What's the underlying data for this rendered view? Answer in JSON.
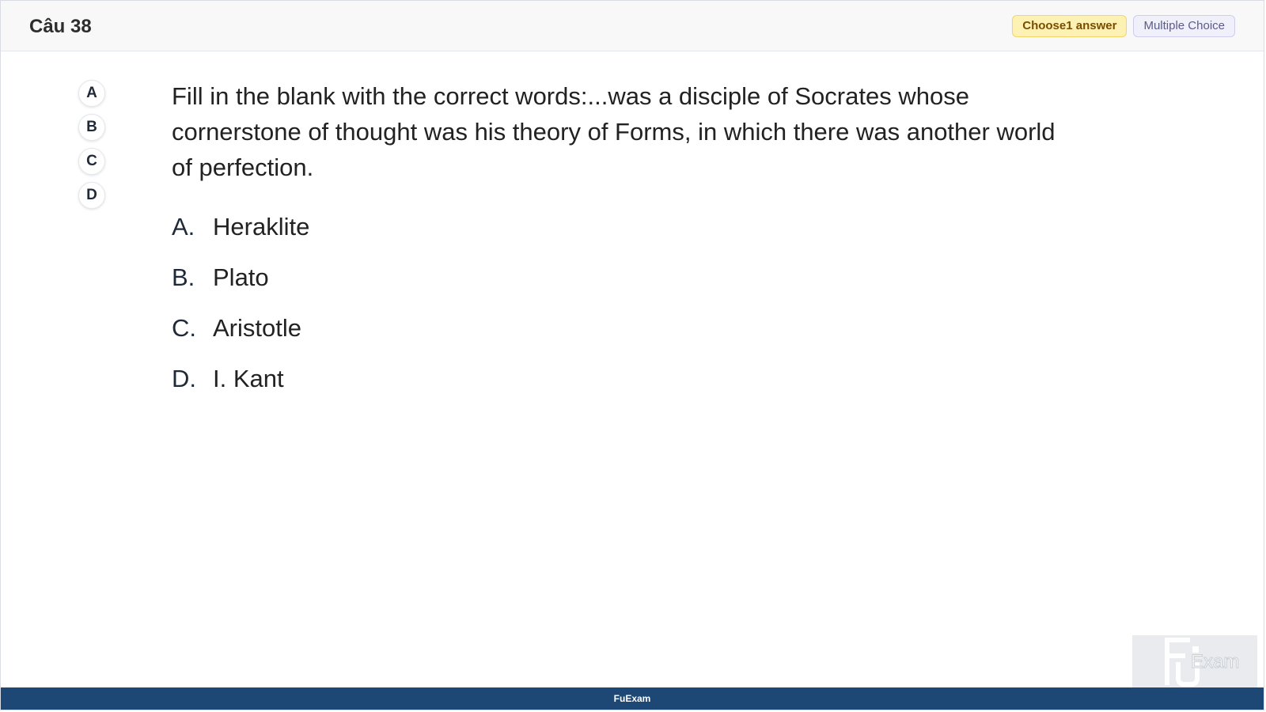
{
  "header": {
    "title": "Câu 38",
    "badges": {
      "choose": "Choose1 answer",
      "type": "Multiple Choice"
    }
  },
  "answer_nav": [
    "A",
    "B",
    "C",
    "D"
  ],
  "question": {
    "text": "Fill in the blank with the correct words:...was a disciple of Socrates whose cornerstone of thought was his theory of Forms, in which there was another world of perfection."
  },
  "options": [
    {
      "letter": "A.",
      "text": "Heraklite"
    },
    {
      "letter": "B.",
      "text": "Plato"
    },
    {
      "letter": "C.",
      "text": "Aristotle"
    },
    {
      "letter": "D.",
      "text": "I. Kant"
    }
  ],
  "footer": {
    "brand": "FuExam"
  },
  "watermark": {
    "text": "Exam"
  },
  "colors": {
    "footer_bg": "#1d4876",
    "badge_choose_bg": "#fdf1b3",
    "badge_type_bg": "#f0f0fb"
  }
}
